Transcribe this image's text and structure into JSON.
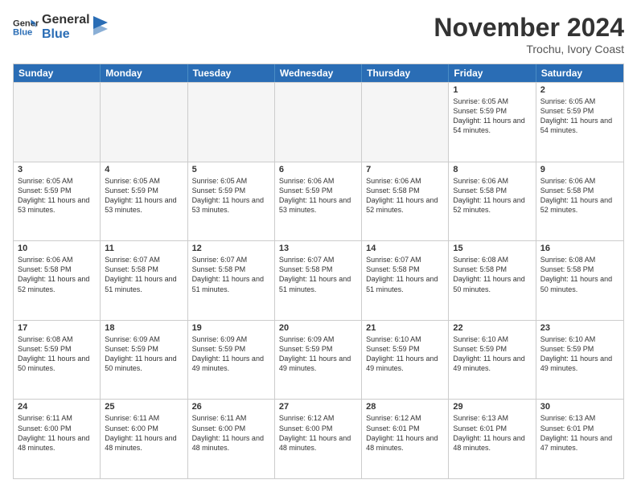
{
  "logo": {
    "line1": "General",
    "line2": "Blue"
  },
  "title": "November 2024",
  "location": "Trochu, Ivory Coast",
  "days_of_week": [
    "Sunday",
    "Monday",
    "Tuesday",
    "Wednesday",
    "Thursday",
    "Friday",
    "Saturday"
  ],
  "rows": [
    [
      {
        "day": "",
        "empty": true
      },
      {
        "day": "",
        "empty": true
      },
      {
        "day": "",
        "empty": true
      },
      {
        "day": "",
        "empty": true
      },
      {
        "day": "",
        "empty": true
      },
      {
        "day": "1",
        "info": "Sunrise: 6:05 AM\nSunset: 5:59 PM\nDaylight: 11 hours\nand 54 minutes."
      },
      {
        "day": "2",
        "info": "Sunrise: 6:05 AM\nSunset: 5:59 PM\nDaylight: 11 hours\nand 54 minutes."
      }
    ],
    [
      {
        "day": "3",
        "info": "Sunrise: 6:05 AM\nSunset: 5:59 PM\nDaylight: 11 hours\nand 53 minutes."
      },
      {
        "day": "4",
        "info": "Sunrise: 6:05 AM\nSunset: 5:59 PM\nDaylight: 11 hours\nand 53 minutes."
      },
      {
        "day": "5",
        "info": "Sunrise: 6:05 AM\nSunset: 5:59 PM\nDaylight: 11 hours\nand 53 minutes."
      },
      {
        "day": "6",
        "info": "Sunrise: 6:06 AM\nSunset: 5:59 PM\nDaylight: 11 hours\nand 53 minutes."
      },
      {
        "day": "7",
        "info": "Sunrise: 6:06 AM\nSunset: 5:58 PM\nDaylight: 11 hours\nand 52 minutes."
      },
      {
        "day": "8",
        "info": "Sunrise: 6:06 AM\nSunset: 5:58 PM\nDaylight: 11 hours\nand 52 minutes."
      },
      {
        "day": "9",
        "info": "Sunrise: 6:06 AM\nSunset: 5:58 PM\nDaylight: 11 hours\nand 52 minutes."
      }
    ],
    [
      {
        "day": "10",
        "info": "Sunrise: 6:06 AM\nSunset: 5:58 PM\nDaylight: 11 hours\nand 52 minutes."
      },
      {
        "day": "11",
        "info": "Sunrise: 6:07 AM\nSunset: 5:58 PM\nDaylight: 11 hours\nand 51 minutes."
      },
      {
        "day": "12",
        "info": "Sunrise: 6:07 AM\nSunset: 5:58 PM\nDaylight: 11 hours\nand 51 minutes."
      },
      {
        "day": "13",
        "info": "Sunrise: 6:07 AM\nSunset: 5:58 PM\nDaylight: 11 hours\nand 51 minutes."
      },
      {
        "day": "14",
        "info": "Sunrise: 6:07 AM\nSunset: 5:58 PM\nDaylight: 11 hours\nand 51 minutes."
      },
      {
        "day": "15",
        "info": "Sunrise: 6:08 AM\nSunset: 5:58 PM\nDaylight: 11 hours\nand 50 minutes."
      },
      {
        "day": "16",
        "info": "Sunrise: 6:08 AM\nSunset: 5:58 PM\nDaylight: 11 hours\nand 50 minutes."
      }
    ],
    [
      {
        "day": "17",
        "info": "Sunrise: 6:08 AM\nSunset: 5:59 PM\nDaylight: 11 hours\nand 50 minutes."
      },
      {
        "day": "18",
        "info": "Sunrise: 6:09 AM\nSunset: 5:59 PM\nDaylight: 11 hours\nand 50 minutes."
      },
      {
        "day": "19",
        "info": "Sunrise: 6:09 AM\nSunset: 5:59 PM\nDaylight: 11 hours\nand 49 minutes."
      },
      {
        "day": "20",
        "info": "Sunrise: 6:09 AM\nSunset: 5:59 PM\nDaylight: 11 hours\nand 49 minutes."
      },
      {
        "day": "21",
        "info": "Sunrise: 6:10 AM\nSunset: 5:59 PM\nDaylight: 11 hours\nand 49 minutes."
      },
      {
        "day": "22",
        "info": "Sunrise: 6:10 AM\nSunset: 5:59 PM\nDaylight: 11 hours\nand 49 minutes."
      },
      {
        "day": "23",
        "info": "Sunrise: 6:10 AM\nSunset: 5:59 PM\nDaylight: 11 hours\nand 49 minutes."
      }
    ],
    [
      {
        "day": "24",
        "info": "Sunrise: 6:11 AM\nSunset: 6:00 PM\nDaylight: 11 hours\nand 48 minutes."
      },
      {
        "day": "25",
        "info": "Sunrise: 6:11 AM\nSunset: 6:00 PM\nDaylight: 11 hours\nand 48 minutes."
      },
      {
        "day": "26",
        "info": "Sunrise: 6:11 AM\nSunset: 6:00 PM\nDaylight: 11 hours\nand 48 minutes."
      },
      {
        "day": "27",
        "info": "Sunrise: 6:12 AM\nSunset: 6:00 PM\nDaylight: 11 hours\nand 48 minutes."
      },
      {
        "day": "28",
        "info": "Sunrise: 6:12 AM\nSunset: 6:01 PM\nDaylight: 11 hours\nand 48 minutes."
      },
      {
        "day": "29",
        "info": "Sunrise: 6:13 AM\nSunset: 6:01 PM\nDaylight: 11 hours\nand 48 minutes."
      },
      {
        "day": "30",
        "info": "Sunrise: 6:13 AM\nSunset: 6:01 PM\nDaylight: 11 hours\nand 47 minutes."
      }
    ]
  ]
}
